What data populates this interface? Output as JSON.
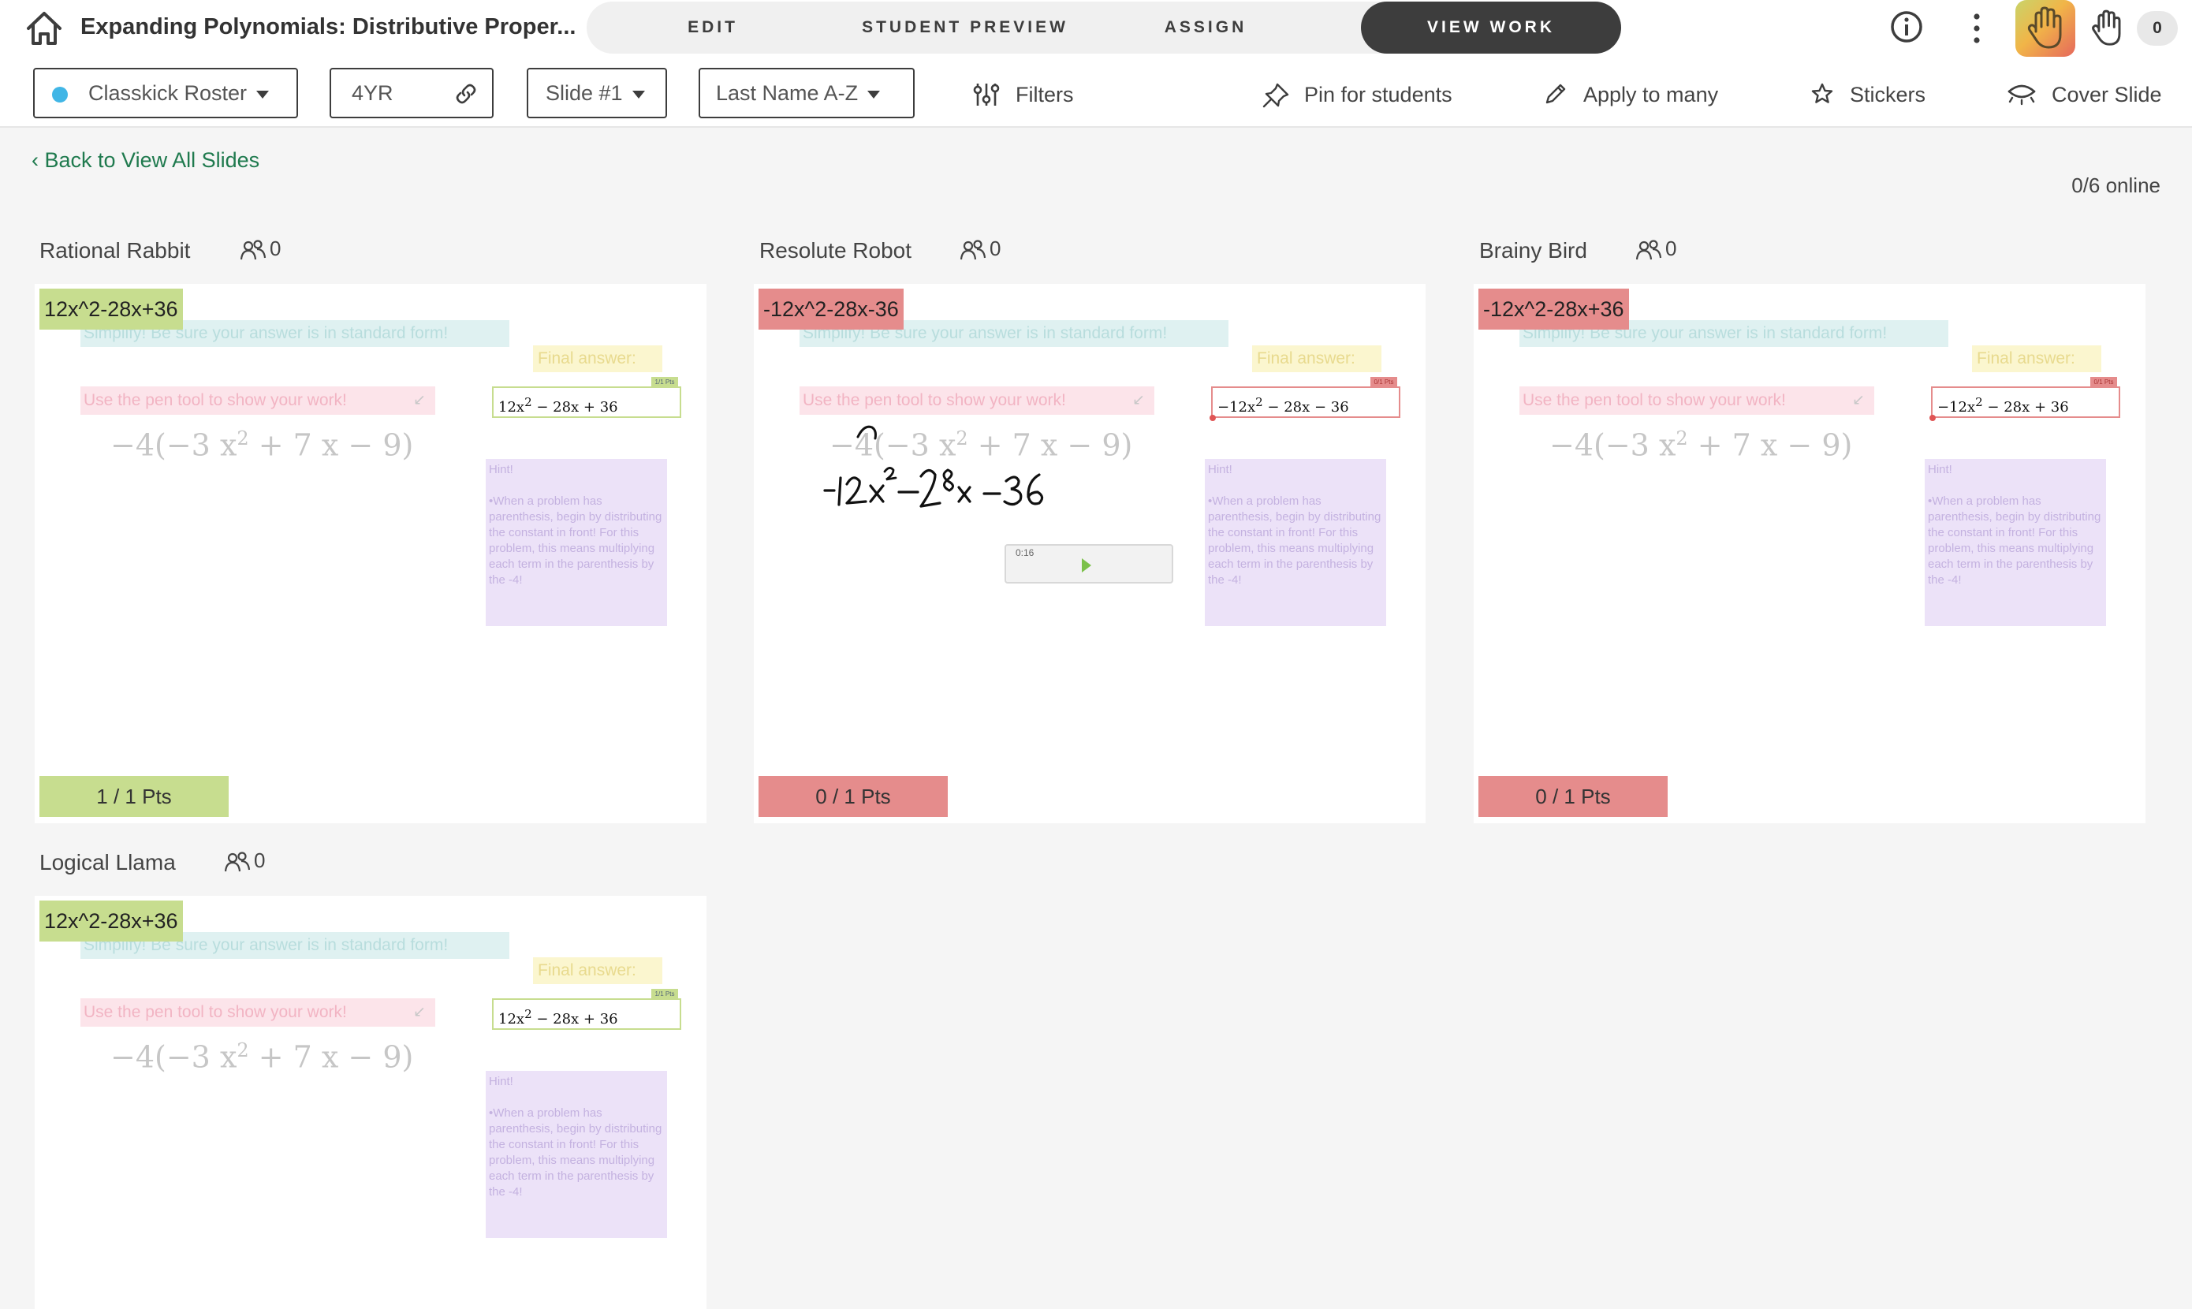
{
  "header": {
    "title": "Expanding Polynomials: Distributive Proper...",
    "tabs": [
      "EDIT",
      "STUDENT PREVIEW",
      "ASSIGN",
      "VIEW WORK"
    ],
    "active_tab": "VIEW WORK",
    "hand_count": "0"
  },
  "toolbar": {
    "roster": "Classkick Roster",
    "class_code": "4YR",
    "slide": "Slide #1",
    "sort": "Last Name A-Z",
    "filters": "Filters",
    "pin": "Pin for students",
    "apply": "Apply to many",
    "stickers": "Stickers",
    "cover": "Cover Slide"
  },
  "back_label": "Back to View All Slides",
  "online_status": "0/6 online",
  "slide": {
    "prompt": "Simplify!  Be sure your answer is in standard form!",
    "final_label": "Final answer:",
    "pen_prompt": "Use the pen tool to show your work!",
    "hint_title": "Hint!",
    "hint_body": "•When a problem has parenthesis, begin by distributing the constant in front!  For this problem, this means multiplying each term in the parenthesis by the -4!"
  },
  "students": [
    {
      "name": "Rational Rabbit",
      "collab": "0",
      "answer": "12x^2-28x+36",
      "input_lead": "12x",
      "input_tail": " − 28x + 36",
      "pts_tag": "1/1 Pts",
      "points": "1 / 1 Pts",
      "status": "correct"
    },
    {
      "name": "Resolute Robot",
      "collab": "0",
      "answer": "-12x^2-28x-36",
      "input_lead": "−12x",
      "input_tail": " − 28x − 36",
      "pts_tag": "0/1 Pts",
      "points": "0 / 1 Pts",
      "status": "incorrect",
      "audio_time": "0:16"
    },
    {
      "name": "Brainy Bird",
      "collab": "0",
      "answer": "-12x^2-28x+36",
      "input_lead": "−12x",
      "input_tail": " − 28x + 36",
      "pts_tag": "0/1 Pts",
      "points": "0 / 1 Pts",
      "status": "incorrect"
    },
    {
      "name": "Logical Llama",
      "collab": "0",
      "answer": "12x^2-28x+36",
      "input_lead": "12x",
      "input_tail": " − 28x + 36",
      "pts_tag": "1/1 Pts",
      "status": "correct"
    }
  ],
  "colors": {
    "correct": "#c7dd8f",
    "incorrect": "#e58c8c",
    "active_tab": "#3d3d3d",
    "link": "#1f7a4e"
  }
}
